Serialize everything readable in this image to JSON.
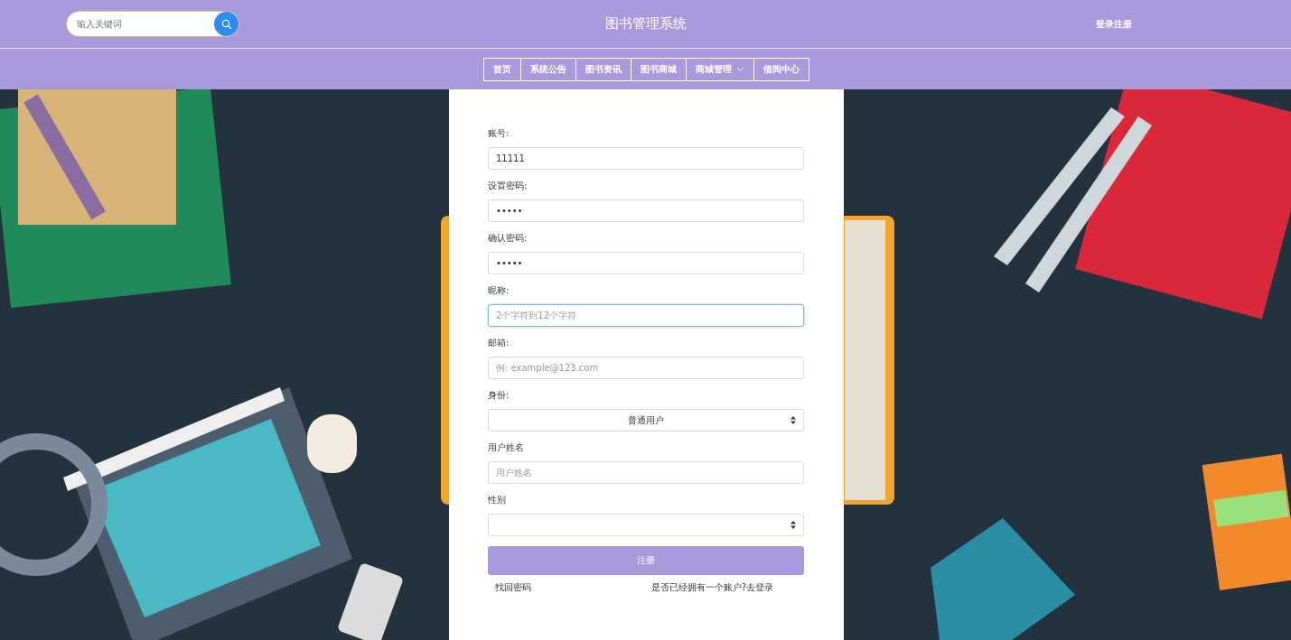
{
  "header": {
    "search": {
      "placeholder": "输入关键词"
    },
    "title": "图书管理系统",
    "auth_link": "登录注册"
  },
  "nav": [
    {
      "label": "首页",
      "has_dropdown": false
    },
    {
      "label": "系统公告",
      "has_dropdown": false
    },
    {
      "label": "图书资讯",
      "has_dropdown": false
    },
    {
      "label": "图书商城",
      "has_dropdown": false
    },
    {
      "label": "商城管理",
      "has_dropdown": true
    },
    {
      "label": "借阅中心",
      "has_dropdown": false
    }
  ],
  "form": {
    "fields": [
      {
        "kind": "input",
        "label": "账号:",
        "value": "11111",
        "focused": false
      },
      {
        "kind": "input",
        "label": "设置密码:",
        "value": "•••••",
        "focused": false
      },
      {
        "kind": "input",
        "label": "确认密码:",
        "value": "•••••",
        "focused": false
      },
      {
        "kind": "input",
        "label": "昵称:",
        "placeholder": "2个字符到12个字符",
        "focused": true
      },
      {
        "kind": "input",
        "label": "邮箱:",
        "placeholder": "例: example@123.com",
        "focused": false
      },
      {
        "kind": "select",
        "label": "身份:",
        "value": "普通用户",
        "focused": false
      },
      {
        "kind": "input",
        "label": "用户姓名",
        "placeholder": "用户姓名",
        "focused": false
      },
      {
        "kind": "select",
        "label": "性别",
        "focused": false
      }
    ],
    "submit": "注册",
    "links": [
      "找回密码",
      "是否已经拥有一个账户?去登录"
    ]
  }
}
